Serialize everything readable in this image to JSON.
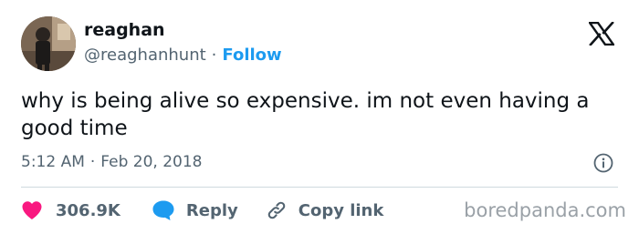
{
  "author": {
    "display_name": "reaghan",
    "handle": "@reaghanhunt",
    "separator": "·",
    "follow_label": "Follow"
  },
  "tweet": {
    "text": "why is being alive so expensive. im not even having a good time"
  },
  "meta": {
    "time": "5:12 AM",
    "separator": "·",
    "date": "Feb 20, 2018"
  },
  "actions": {
    "like_count": "306.9K",
    "reply_label": "Reply",
    "copy_link_label": "Copy link"
  },
  "watermark": "boredpanda.com",
  "icons": {
    "logo": "x-logo-icon",
    "info": "info-icon",
    "like": "heart-icon",
    "reply": "speech-bubble-icon",
    "copy": "link-icon"
  },
  "colors": {
    "accent": "#1d9bf0",
    "like": "#f91880",
    "text_primary": "#0f1419",
    "text_secondary": "#536471"
  }
}
